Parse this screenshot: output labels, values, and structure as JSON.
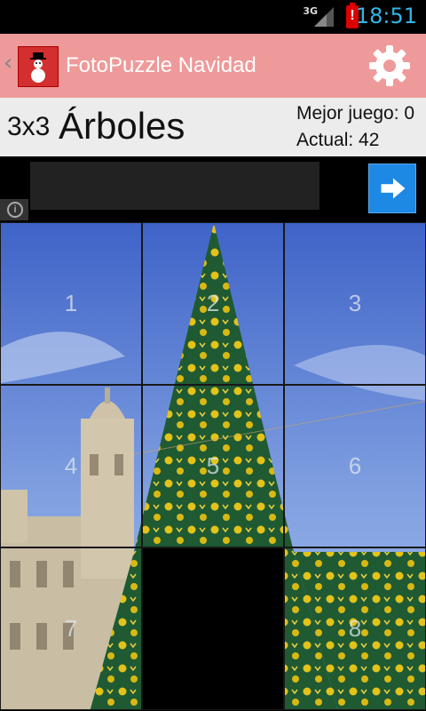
{
  "status": {
    "network": "3G",
    "time": "18:51"
  },
  "app": {
    "title": "FotoPuzzle Navidad"
  },
  "game": {
    "size": "3x3",
    "theme": "Árboles",
    "best": "Mejor juego: 0",
    "current": "Actual: 42"
  },
  "board": {
    "tiles": [
      {
        "label": "1",
        "empty": false
      },
      {
        "label": "2",
        "empty": false
      },
      {
        "label": "3",
        "empty": false
      },
      {
        "label": "4",
        "empty": false
      },
      {
        "label": "5",
        "empty": false
      },
      {
        "label": "6",
        "empty": false
      },
      {
        "label": "7",
        "empty": false
      },
      {
        "label": "",
        "empty": true
      },
      {
        "label": "8",
        "empty": false
      }
    ]
  },
  "colors": {
    "actionbar": "#ef9a9a",
    "clock": "#33b5e5",
    "ad_button": "#1e88e5"
  },
  "icons": [
    "snowman-icon",
    "gear-icon",
    "arrow-right-icon",
    "info-icon",
    "chevron-left-icon"
  ]
}
